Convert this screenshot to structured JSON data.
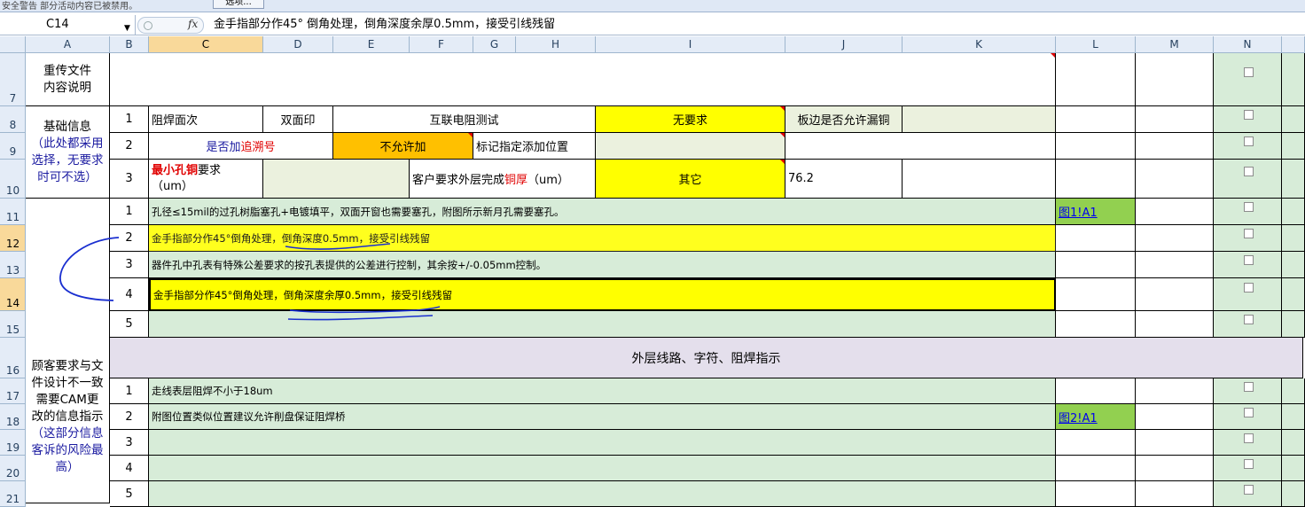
{
  "toolbar": {
    "strip_text": "安全警告 部分活动内容已被禁用。",
    "options_button": "选项..."
  },
  "formula_bar": {
    "name_box": "C14",
    "fx_label": "fx",
    "content": "金手指部分作45° 倒角处理，倒角深度余厚0.5mm，接受引线残留"
  },
  "columns": [
    "A",
    "B",
    "C",
    "D",
    "E",
    "F",
    "G",
    "H",
    "I",
    "J",
    "K",
    "L",
    "M",
    "N"
  ],
  "rows": [
    "7",
    "8",
    "9",
    "10",
    "11",
    "12",
    "13",
    "14",
    "15",
    "16",
    "17",
    "18",
    "19",
    "20",
    "21"
  ],
  "sheet": {
    "r7_label": "重传文件\n内容说明",
    "basic_label_1": "基础信息",
    "basic_label_2": "（此处都采用\n选择，无要求\n时可不选）",
    "r8": {
      "num": "1",
      "c": "阻焊面次",
      "d": "双面印",
      "ef": "互联电阻测试",
      "i": "无要求",
      "j": "板边是否允许漏铜",
      "k": ""
    },
    "r9": {
      "num": "2",
      "cd_1": "是否加",
      "cd_2": "追溯号",
      "e": "不允许加",
      "gh": "标记指定添加位置",
      "i": "",
      "j": ""
    },
    "r10": {
      "num": "3",
      "c_1": "最小孔铜",
      "c_2": "要求",
      "c_3": "（um）",
      "gh_1": "客户要求外层完成",
      "gh_2": "铜厚",
      "gh_3": "（um）",
      "i": "其它",
      "j": "76.2"
    },
    "r11": {
      "num": "1",
      "text": "孔径≤15mil的过孔树脂塞孔+电镀填平，双面开窗也需要塞孔，附图所示新月孔需要塞孔。",
      "link": "图1!A1"
    },
    "r12": {
      "num": "2",
      "text": "金手指部分作45°倒角处理，倒角深度0.5mm，接受引线残留"
    },
    "r13": {
      "num": "3",
      "text": "器件孔中孔表有特殊公差要求的按孔表提供的公差进行控制，其余按+/-0.05mm控制。"
    },
    "r14": {
      "num": "4",
      "text": "金手指部分作45°倒角处理，倒角深度余厚0.5mm，接受引线残留"
    },
    "r15": {
      "num": "5",
      "text": ""
    },
    "r16": {
      "title": "外层线路、字符、阻焊指示"
    },
    "r17": {
      "num": "1",
      "text": "走线表层阻焊不小于18um"
    },
    "r18": {
      "num": "2",
      "text": "附图位置类似位置建议允许削盘保证阻焊桥",
      "link": "图2!A1"
    },
    "r19": {
      "num": "3",
      "text": ""
    },
    "r20": {
      "num": "4",
      "text": ""
    },
    "r21": {
      "num": "5",
      "text": ""
    },
    "customer_label_1": "顾客要求与文\n件设计不一致\n需要CAM更\n改的信息指示",
    "customer_label_2": "（这部分信息\n客诉的风险最\n高）"
  },
  "colors": {
    "yellow": "#ffff00",
    "orange": "#ffc000",
    "lime": "#92d050",
    "green": "#ebf1de",
    "header": "#e4ecf7",
    "selected_header": "#f9d99a"
  }
}
